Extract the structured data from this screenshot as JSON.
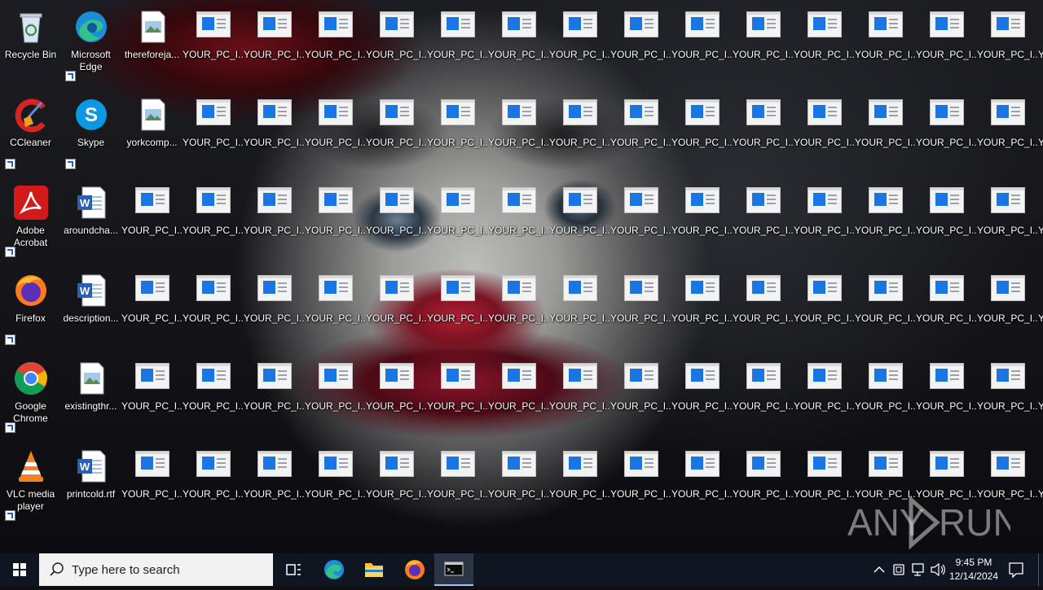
{
  "desktop": {
    "left_icons": [
      {
        "label": "Recycle Bin",
        "icon": "recycle-bin-icon"
      },
      {
        "label": "Microsoft Edge",
        "icon": "edge-icon"
      },
      {
        "label": "thereforejа...",
        "icon": "image-file-icon"
      },
      {
        "label": "CCleaner",
        "icon": "ccleaner-icon"
      },
      {
        "label": "Skype",
        "icon": "skype-icon"
      },
      {
        "label": "yorkcomp...",
        "icon": "image-file-icon"
      },
      {
        "label": "Adobe Acrobat",
        "icon": "acrobat-icon"
      },
      {
        "label": "aroundcha...",
        "icon": "word-doc-icon"
      },
      {
        "label": "Firefox",
        "icon": "firefox-icon"
      },
      {
        "label": "description...",
        "icon": "word-doc-icon"
      },
      {
        "label": "Google Chrome",
        "icon": "chrome-icon"
      },
      {
        "label": "existingthr...",
        "icon": "image-file-icon"
      },
      {
        "label": "VLC media player",
        "icon": "vlc-icon"
      },
      {
        "label": "printcold.rtf",
        "icon": "word-doc-icon"
      }
    ],
    "tile_label": "YOUR_PC_I...",
    "watermark": {
      "left": "ANY",
      "right": "RUN"
    }
  },
  "taskbar": {
    "search_placeholder": "Type here to search",
    "clock_time": "9:45 PM",
    "clock_date": "12/14/2024"
  },
  "colors": {
    "taskbar_bg": "#0f1622",
    "tile_blue": "#1976e3"
  }
}
